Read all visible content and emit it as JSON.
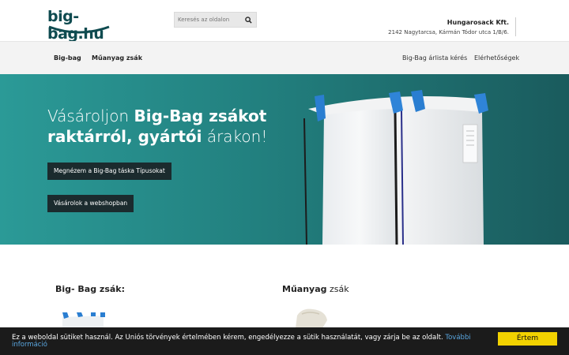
{
  "header": {
    "logo_text": "big-bag.hu",
    "search_placeholder": "Keresés az oldalon",
    "company_name": "Hungarosack Kft.",
    "company_address": "2142 Nagytarcsa, Kármán Tódor utca 1/B/6."
  },
  "nav": {
    "left": [
      "Big-bag",
      "Műanyag zsák"
    ],
    "right": [
      "Big-Bag árlista kérés",
      "Elérhetőségek"
    ]
  },
  "hero": {
    "title_part1": "Vásároljon ",
    "title_bold": "Big-Bag zsákot raktárról, gyártói",
    "title_part2": " árakon!",
    "button1": "Megnézem a Big-Bag táska Típusokat",
    "button2": "Vásárolok a webshopban"
  },
  "sections": {
    "left_title_bold": "Big- Bag zsák:",
    "right_title_bold": "Műanyag",
    "right_title_rest": " zsák"
  },
  "cookie": {
    "text": "Ez a weboldal sütiket használ. Az Uniós törvények értelmében kérem, engedélyezze a sütik használatát, vagy zárja be az oldalt. ",
    "link": "További információ",
    "button": "Értem"
  },
  "colors": {
    "brand_dark": "#0f4b50",
    "hero_left": "#2b9a97",
    "hero_right": "#1a5b5d",
    "button_dark": "#1b2b2e",
    "cookie_accent": "#f2d200",
    "link_blue": "#5aa7e0"
  }
}
